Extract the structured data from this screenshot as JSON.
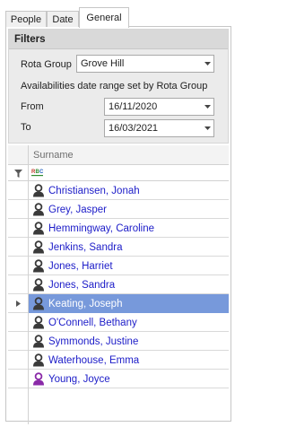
{
  "tabs": [
    {
      "label": "People",
      "active": false
    },
    {
      "label": "Date",
      "active": false
    },
    {
      "label": "General",
      "active": true
    }
  ],
  "filters": {
    "title": "Filters",
    "rota_group_label": "Rota Group",
    "rota_group_value": "Grove Hill",
    "note": "Availabilities date range set by Rota Group",
    "from_label": "From",
    "from_value": "16/11/2020",
    "to_label": "To",
    "to_value": "16/03/2021"
  },
  "grid": {
    "column_header": "Surname",
    "filter_row_icon": "rbc-text-filter-icon",
    "rows": [
      {
        "name": "Christiansen, Jonah",
        "icon": "person-icon",
        "icon_color": "#3a3a3a",
        "selected": false
      },
      {
        "name": "Grey, Jasper",
        "icon": "person-icon",
        "icon_color": "#3a3a3a",
        "selected": false
      },
      {
        "name": "Hemmingway, Caroline",
        "icon": "person-icon",
        "icon_color": "#3a3a3a",
        "selected": false
      },
      {
        "name": "Jenkins, Sandra",
        "icon": "person-icon",
        "icon_color": "#3a3a3a",
        "selected": false
      },
      {
        "name": "Jones, Harriet",
        "icon": "person-icon",
        "icon_color": "#3a3a3a",
        "selected": false
      },
      {
        "name": "Jones, Sandra",
        "icon": "person-icon",
        "icon_color": "#3a3a3a",
        "selected": false
      },
      {
        "name": "Keating, Joseph",
        "icon": "person-icon",
        "icon_color": "#3a3a3a",
        "selected": true
      },
      {
        "name": "O'Connell, Bethany",
        "icon": "person-icon",
        "icon_color": "#3a3a3a",
        "selected": false
      },
      {
        "name": "Symmonds, Justine",
        "icon": "person-icon",
        "icon_color": "#3a3a3a",
        "selected": false
      },
      {
        "name": "Waterhouse, Emma",
        "icon": "person-icon",
        "icon_color": "#3a3a3a",
        "selected": false
      },
      {
        "name": "Young, Joyce",
        "icon": "person-icon",
        "icon_color": "#8a2aa8",
        "selected": false
      }
    ]
  },
  "colors": {
    "selection": "#7799db",
    "link_text": "#1c1cc8"
  }
}
